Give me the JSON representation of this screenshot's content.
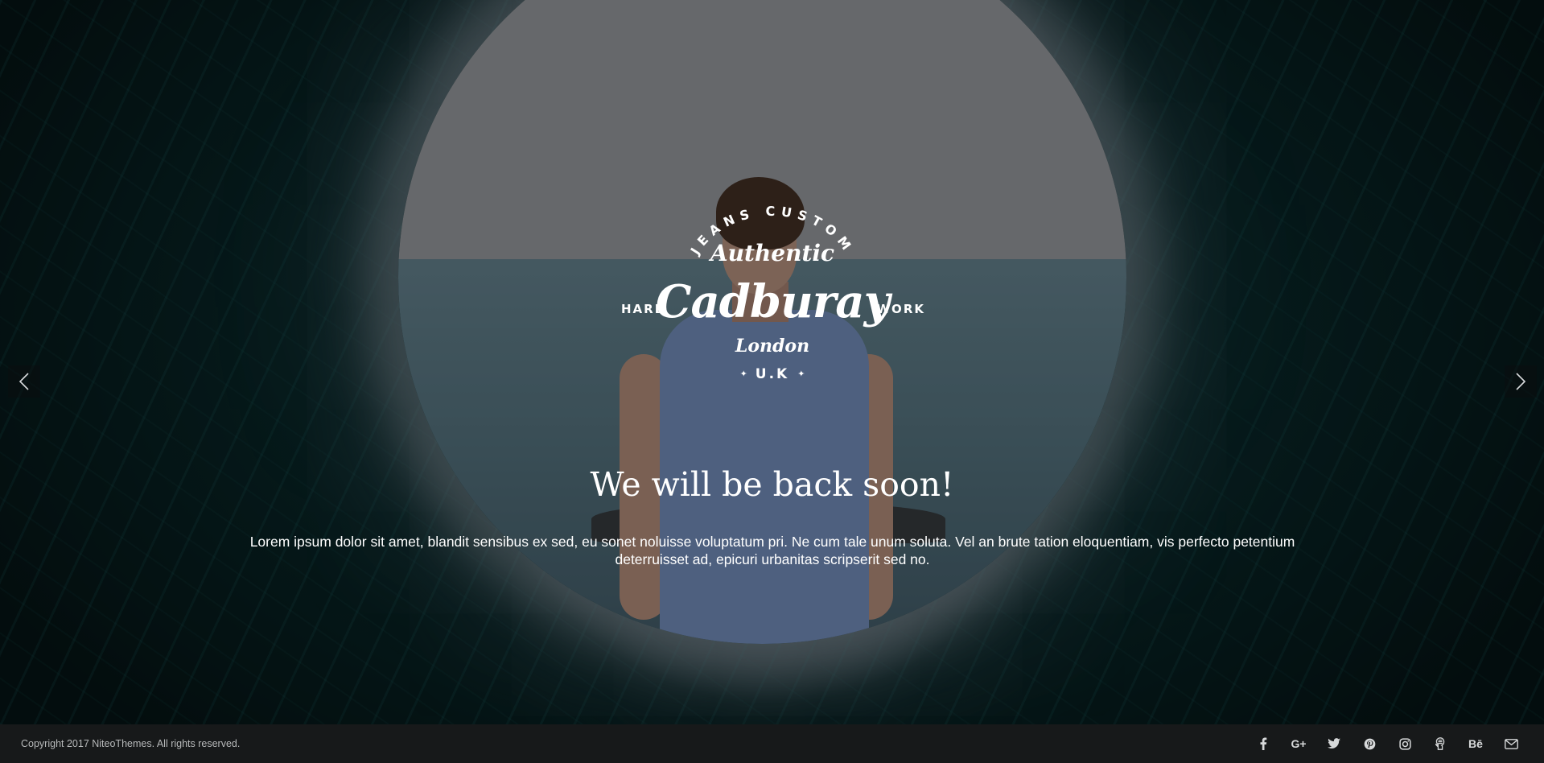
{
  "logo": {
    "arc_text": "JEANS CUSTOM",
    "tagline": "Authentic",
    "brand": "Cadburay",
    "left": "HARD",
    "right": "WORK",
    "city": "London",
    "country": "U.K"
  },
  "hero": {
    "headline": "We will be back soon!",
    "description": "Lorem ipsum dolor sit amet, blandit sensibus ex sed, eu sonet noluisse voluptatum pri. Ne cum tale unum soluta. Vel an brute tation eloquentiam, vis perfecto petentium deterruisset ad, epicuri urbanitas scripserit sed no."
  },
  "slider": {
    "prev_icon": "chevron-left-icon",
    "next_icon": "chevron-right-icon"
  },
  "footer": {
    "copyright": "Copyright 2017 NiteoThemes. All rights reserved.",
    "social": [
      {
        "icon": "facebook-icon",
        "label": "f"
      },
      {
        "icon": "google-plus-icon",
        "label": "G+"
      },
      {
        "icon": "twitter-icon",
        "label": "twitter"
      },
      {
        "icon": "pinterest-icon",
        "label": "pinterest"
      },
      {
        "icon": "instagram-icon",
        "label": "instagram"
      },
      {
        "icon": "github-icon",
        "label": "github"
      },
      {
        "icon": "behance-icon",
        "label": "Bē"
      },
      {
        "icon": "mail-icon",
        "label": "mail"
      }
    ]
  },
  "colors": {
    "footer_bg": "#17191a",
    "text": "#ffffff",
    "footer_text": "#b7b9ba"
  }
}
